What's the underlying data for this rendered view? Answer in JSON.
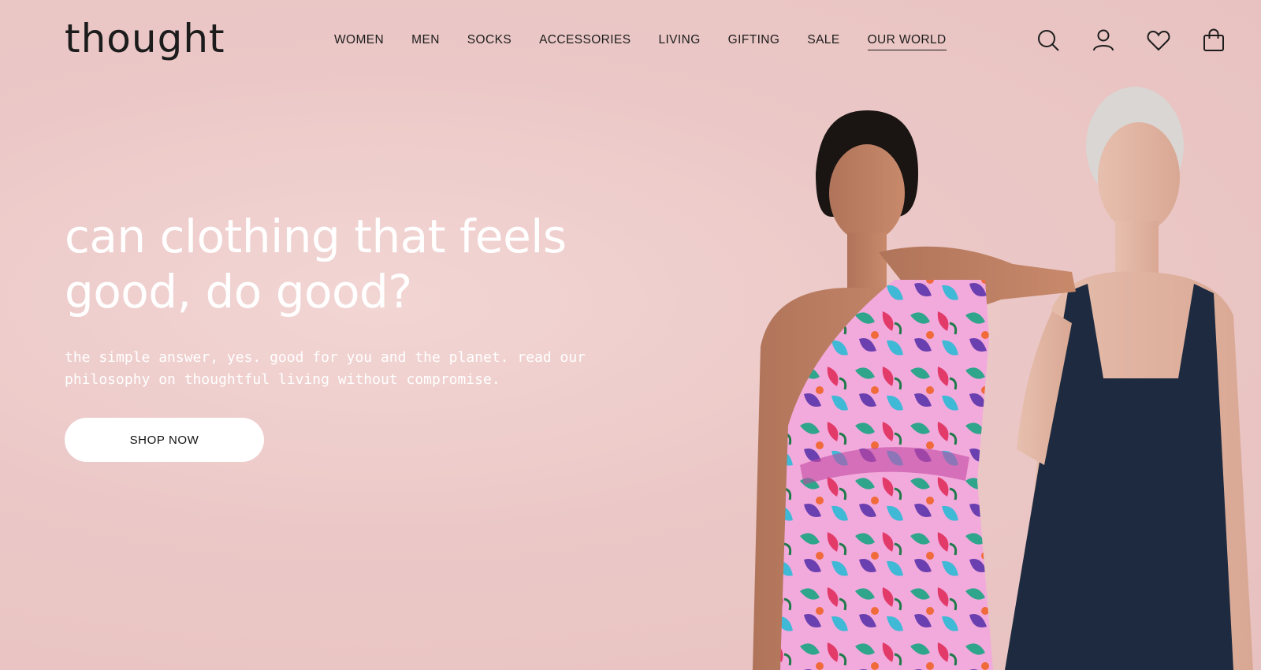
{
  "brand": {
    "logo_text": "thought"
  },
  "nav": {
    "items": [
      {
        "label": "WOMEN"
      },
      {
        "label": "MEN"
      },
      {
        "label": "SOCKS"
      },
      {
        "label": "ACCESSORIES"
      },
      {
        "label": "LIVING"
      },
      {
        "label": "GIFTING"
      },
      {
        "label": "SALE"
      },
      {
        "label": "OUR WORLD",
        "active": true
      }
    ]
  },
  "header_icons": [
    "search-icon",
    "account-icon",
    "wishlist-heart-icon",
    "shopping-bag-icon"
  ],
  "hero": {
    "headline_line1": "can clothing that feels",
    "headline_line2": "good, do good?",
    "subtext_line1": "the simple answer, yes. good for you and the planet. read our",
    "subtext_line2": "philosophy on thoughtful living without compromise.",
    "cta_label": "SHOP NOW"
  },
  "colors": {
    "background": "#ecc9c8",
    "headline": "#ffffff",
    "button_bg": "#ffffff",
    "text_dark": "#1c1c1c",
    "navy_top": "#1d2a3f",
    "print_pink": "#e060c0"
  }
}
